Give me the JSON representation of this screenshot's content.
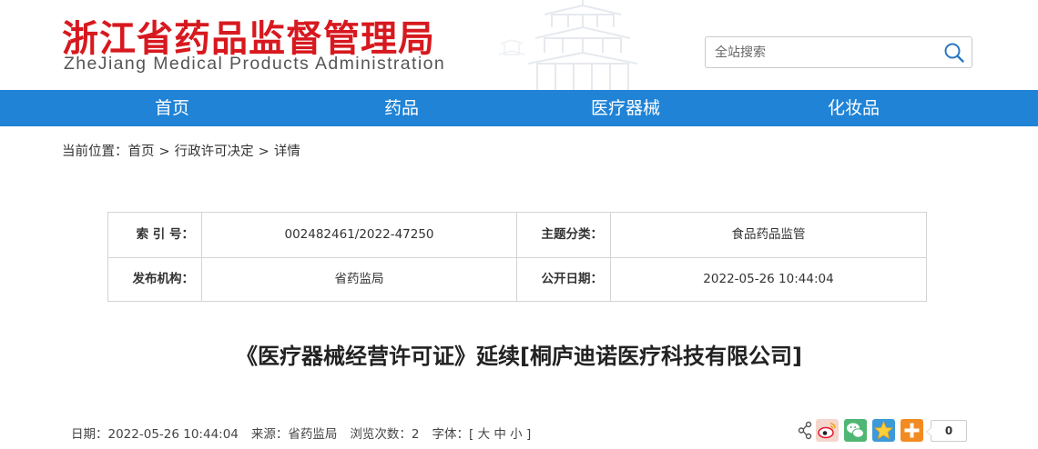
{
  "header": {
    "site_title": "浙江省药品监督管理局",
    "site_subtitle": "ZheJiang Medical Products Administration",
    "search": {
      "placeholder": "全站搜索"
    }
  },
  "nav": {
    "items": [
      {
        "label": "首页"
      },
      {
        "label": "药品"
      },
      {
        "label": "医疗器械"
      },
      {
        "label": "化妆品"
      }
    ]
  },
  "breadcrumb": {
    "prefix": "当前位置：",
    "items": [
      "首页",
      "行政许可决定",
      "详情"
    ],
    "separator": ">"
  },
  "meta": {
    "index_label": "索 引 号：",
    "index_value": "002482461/2022-47250",
    "category_label": "主题分类：",
    "category_value": "食品药品监管",
    "publisher_label": "发布机构：",
    "publisher_value": "省药监局",
    "date_label": "公开日期：",
    "date_value": "2022-05-26 10:44:04"
  },
  "article": {
    "title": "《医疗器械经营许可证》延续[桐庐迪诺医疗科技有限公司]"
  },
  "info": {
    "date_label": "日期：",
    "date_value": "2022-05-26 10:44:04",
    "source_label": "来源：",
    "source_value": "省药监局",
    "views_label": "浏览次数：",
    "views_value": "2",
    "font_label": "字体：[",
    "font_large": "大",
    "font_medium": "中",
    "font_small": "小",
    "font_close": "]"
  },
  "share": {
    "count": "0",
    "icons": [
      "share-icon",
      "weibo-icon",
      "wechat-icon",
      "qzone-icon",
      "more-icon"
    ]
  },
  "colors": {
    "brand_red": "#d7191f",
    "nav_blue": "#2083d6"
  }
}
